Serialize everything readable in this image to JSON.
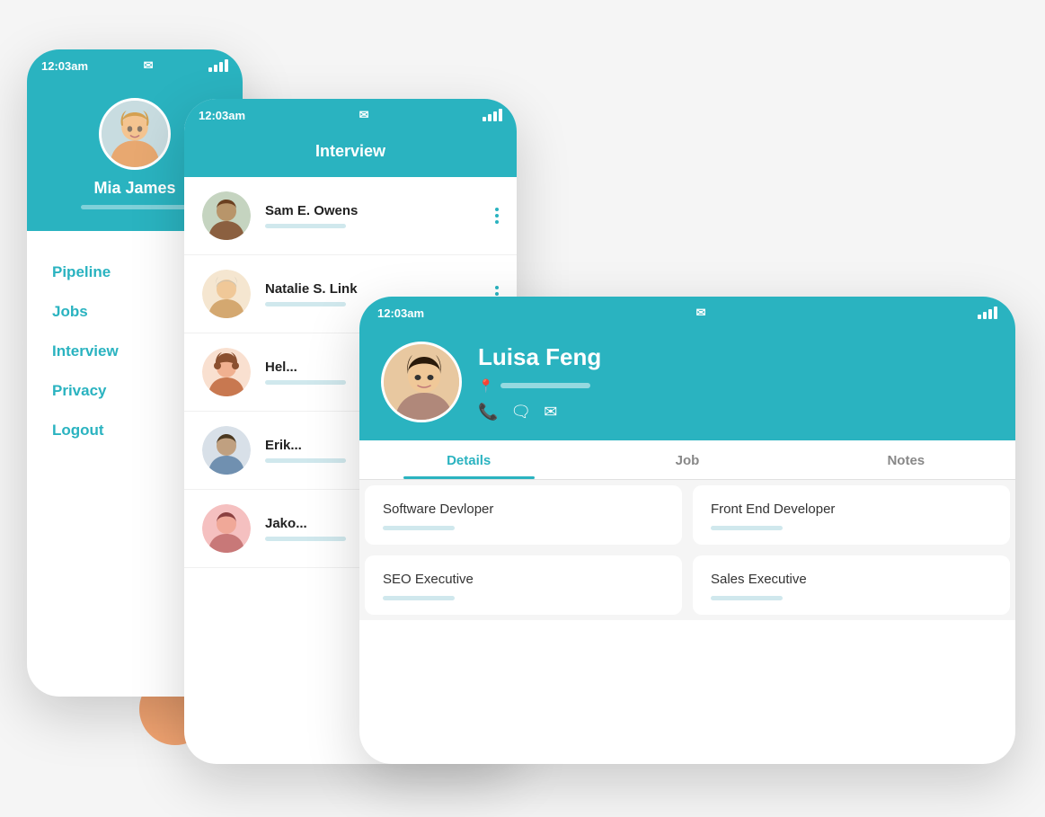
{
  "colors": {
    "teal": "#2ab3c0",
    "white": "#ffffff",
    "lightGray": "#f5f5f5",
    "accent": "#f5a673"
  },
  "phone1": {
    "statusBar": {
      "time": "12:03am",
      "icon": "💬"
    },
    "profile": {
      "name": "Mia James"
    },
    "nav": {
      "items": [
        "Pipeline",
        "Jobs",
        "Interview",
        "Privacy",
        "Logout"
      ]
    }
  },
  "phone2": {
    "statusBar": {
      "time": "12:03am",
      "icon": "💬"
    },
    "header": "Interview",
    "candidates": [
      {
        "name": "Sam E. Owens",
        "id": "1"
      },
      {
        "name": "Natalie S. Link",
        "id": "2"
      },
      {
        "name": "Hel...",
        "id": "3"
      },
      {
        "name": "Erik...",
        "id": "4"
      },
      {
        "name": "Jako...",
        "id": "5"
      }
    ]
  },
  "phone3": {
    "statusBar": {
      "time": "12:03am",
      "icon": "💬"
    },
    "profile": {
      "name": "Luisa Feng"
    },
    "tabs": [
      {
        "label": "Details",
        "active": true
      },
      {
        "label": "Job",
        "active": false
      },
      {
        "label": "Notes",
        "active": false
      }
    ],
    "jobs": [
      {
        "title": "Software Devloper"
      },
      {
        "title": "Front End Developer"
      },
      {
        "title": "SEO Executive"
      },
      {
        "title": "Sales Executive"
      }
    ]
  }
}
